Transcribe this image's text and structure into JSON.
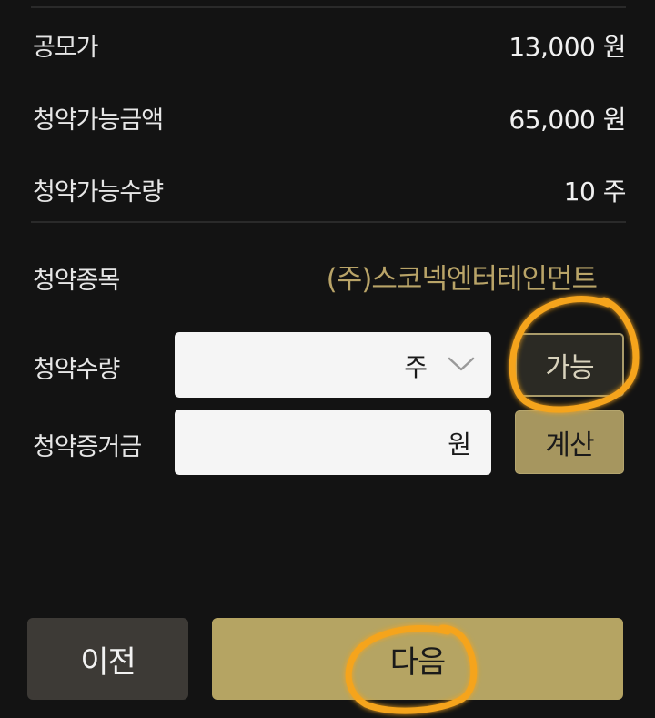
{
  "summary": {
    "rows": [
      {
        "label": "공모가",
        "value": "13,000 원"
      },
      {
        "label": "청약가능금액",
        "value": "65,000 원"
      },
      {
        "label": "청약가능수량",
        "value": "10 주"
      }
    ]
  },
  "form": {
    "stock_label": "청약종목",
    "stock_name": "(주)스코넥엔터테인먼트",
    "quantity_label": "청약수량",
    "quantity_unit": "주",
    "quantity_value": "",
    "quantity_button": "가능",
    "deposit_label": "청약증거금",
    "deposit_unit": "원",
    "deposit_value": "",
    "deposit_button": "계산"
  },
  "footer": {
    "prev_label": "이전",
    "next_label": "다음"
  },
  "colors": {
    "accent_gold": "#b5a463",
    "stock_name_gold": "#b9a468",
    "annotation_orange": "#f5a41d"
  },
  "icons": {
    "quantity_dropdown": "chevron-down-icon"
  }
}
